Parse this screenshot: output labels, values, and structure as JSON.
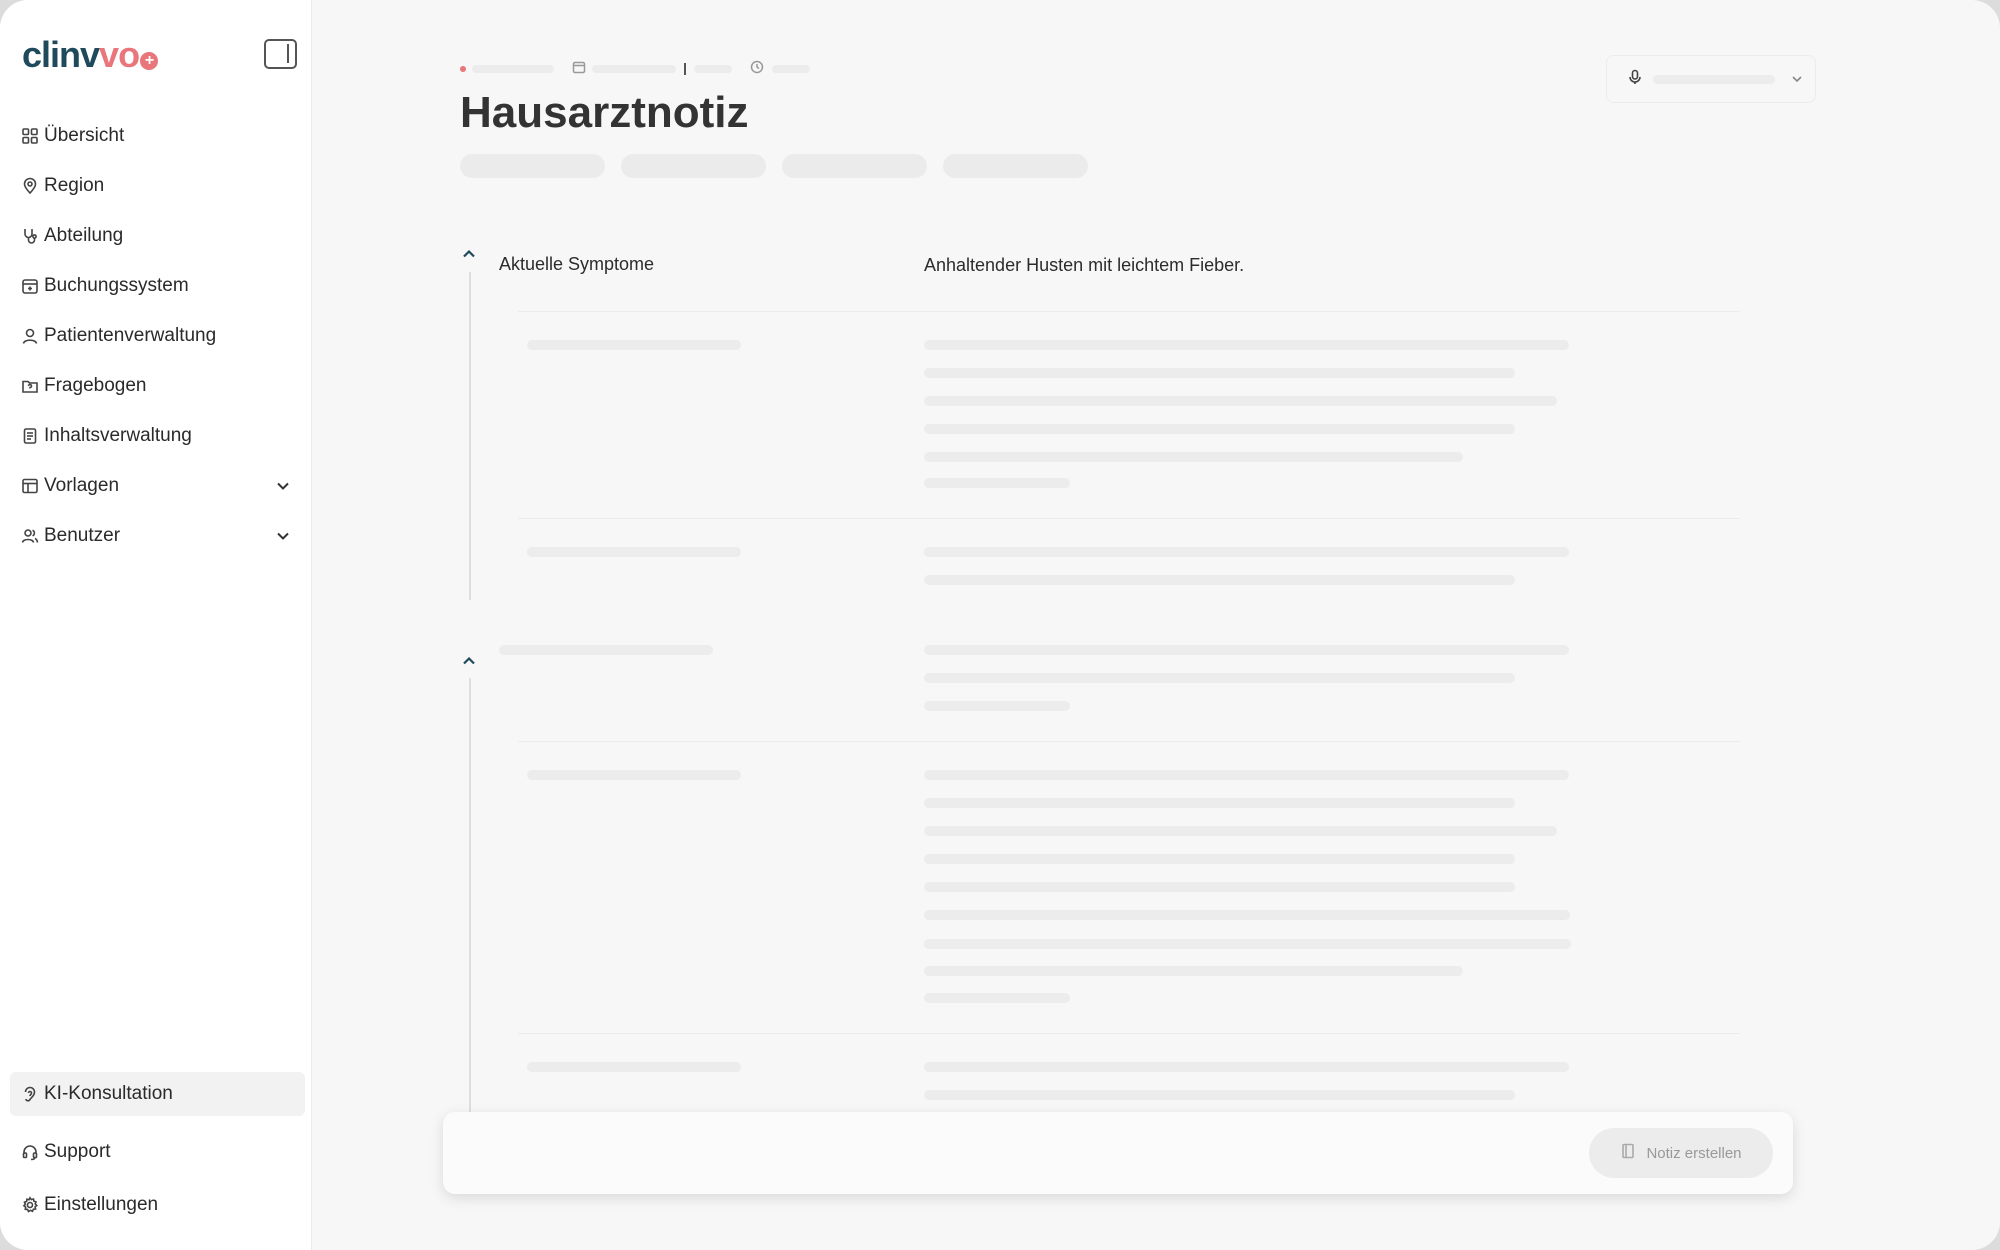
{
  "app": {
    "logo_text_main": "clinv",
    "logo_text_accent": "vo",
    "logo_plus": "+"
  },
  "sidebar": {
    "items": [
      {
        "label": "Übersicht",
        "icon": "grid-icon"
      },
      {
        "label": "Region",
        "icon": "map-pin-icon"
      },
      {
        "label": "Abteilung",
        "icon": "stethoscope-icon"
      },
      {
        "label": "Buchungssystem",
        "icon": "calendar-plus-icon"
      },
      {
        "label": "Patientenverwaltung",
        "icon": "user-icon"
      },
      {
        "label": "Fragebogen",
        "icon": "folder-question-icon"
      },
      {
        "label": "Inhaltsverwaltung",
        "icon": "document-icon"
      },
      {
        "label": "Vorlagen",
        "icon": "table-icon",
        "expandable": true
      },
      {
        "label": "Benutzer",
        "icon": "users-icon",
        "expandable": true
      }
    ],
    "bottom_items": [
      {
        "label": "KI-Konsultation",
        "icon": "ear-icon",
        "active": true
      },
      {
        "label": "Support",
        "icon": "headset-icon"
      },
      {
        "label": "Einstellungen",
        "icon": "gear-icon"
      }
    ]
  },
  "main": {
    "title": "Hausarztnotiz",
    "sections": [
      {
        "label": "Aktuelle Symptome",
        "value": "Anhaltender Husten mit leichtem Fieber."
      }
    ]
  },
  "composer": {
    "create_label": "Notiz erstellen"
  },
  "colors": {
    "brand": "#1f4a5c",
    "accent": "#e8767a"
  }
}
